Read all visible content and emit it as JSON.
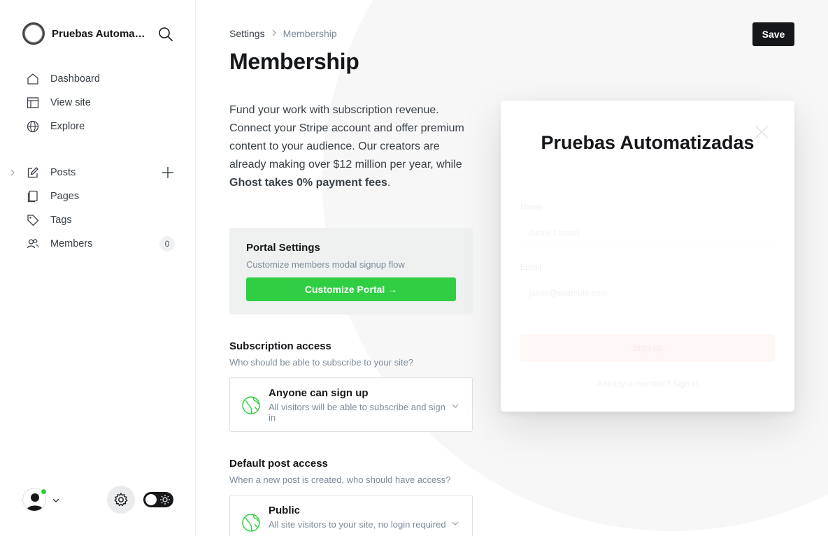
{
  "site": {
    "name": "Pruebas Automatizadas"
  },
  "nav_primary": [
    {
      "label": "Dashboard",
      "icon": "home-icon"
    },
    {
      "label": "View site",
      "icon": "layout-icon"
    },
    {
      "label": "Explore",
      "icon": "globe-icon"
    }
  ],
  "nav_content": [
    {
      "label": "Posts",
      "icon": "pencil-icon"
    },
    {
      "label": "Pages",
      "icon": "pages-icon"
    },
    {
      "label": "Tags",
      "icon": "tag-icon"
    },
    {
      "label": "Members",
      "icon": "members-icon",
      "count": "0"
    }
  ],
  "header": {
    "breadcrumb_root": "Settings",
    "breadcrumb_current": "Membership",
    "title": "Membership",
    "save_label": "Save"
  },
  "intro": {
    "text": "Fund your work with subscription revenue. Connect your Stripe account and offer premium content to your audience. Our creators are already making over $12 million per year, while ",
    "bold": "Ghost takes 0% payment fees",
    "end": "."
  },
  "portal": {
    "title": "Portal Settings",
    "description": "Customize members modal signup flow",
    "button_label": "Customize Portal →"
  },
  "subscription_access": {
    "title": "Subscription access",
    "description": "Who should be able to subscribe to your site?",
    "option_title": "Anyone can sign up",
    "option_description": "All visitors will be able to subscribe and sign in"
  },
  "default_post_access": {
    "title": "Default post access",
    "description": "When a new post is created, who should have access?",
    "option_title": "Public",
    "option_description": "All site visitors to your site, no login required"
  },
  "preview": {
    "site_title": "Pruebas Automatizadas",
    "name_label": "Name",
    "name_placeholder": "Jamie Larson",
    "email_label": "Email",
    "email_placeholder": "jamie@example.com",
    "signup_button": "Sign up",
    "signin_prompt": "Already a member? Sign in"
  },
  "colors": {
    "accent_green": "#30cf43",
    "dark": "#15171a",
    "muted": "#7c8b9a",
    "online": "#30cf43"
  }
}
